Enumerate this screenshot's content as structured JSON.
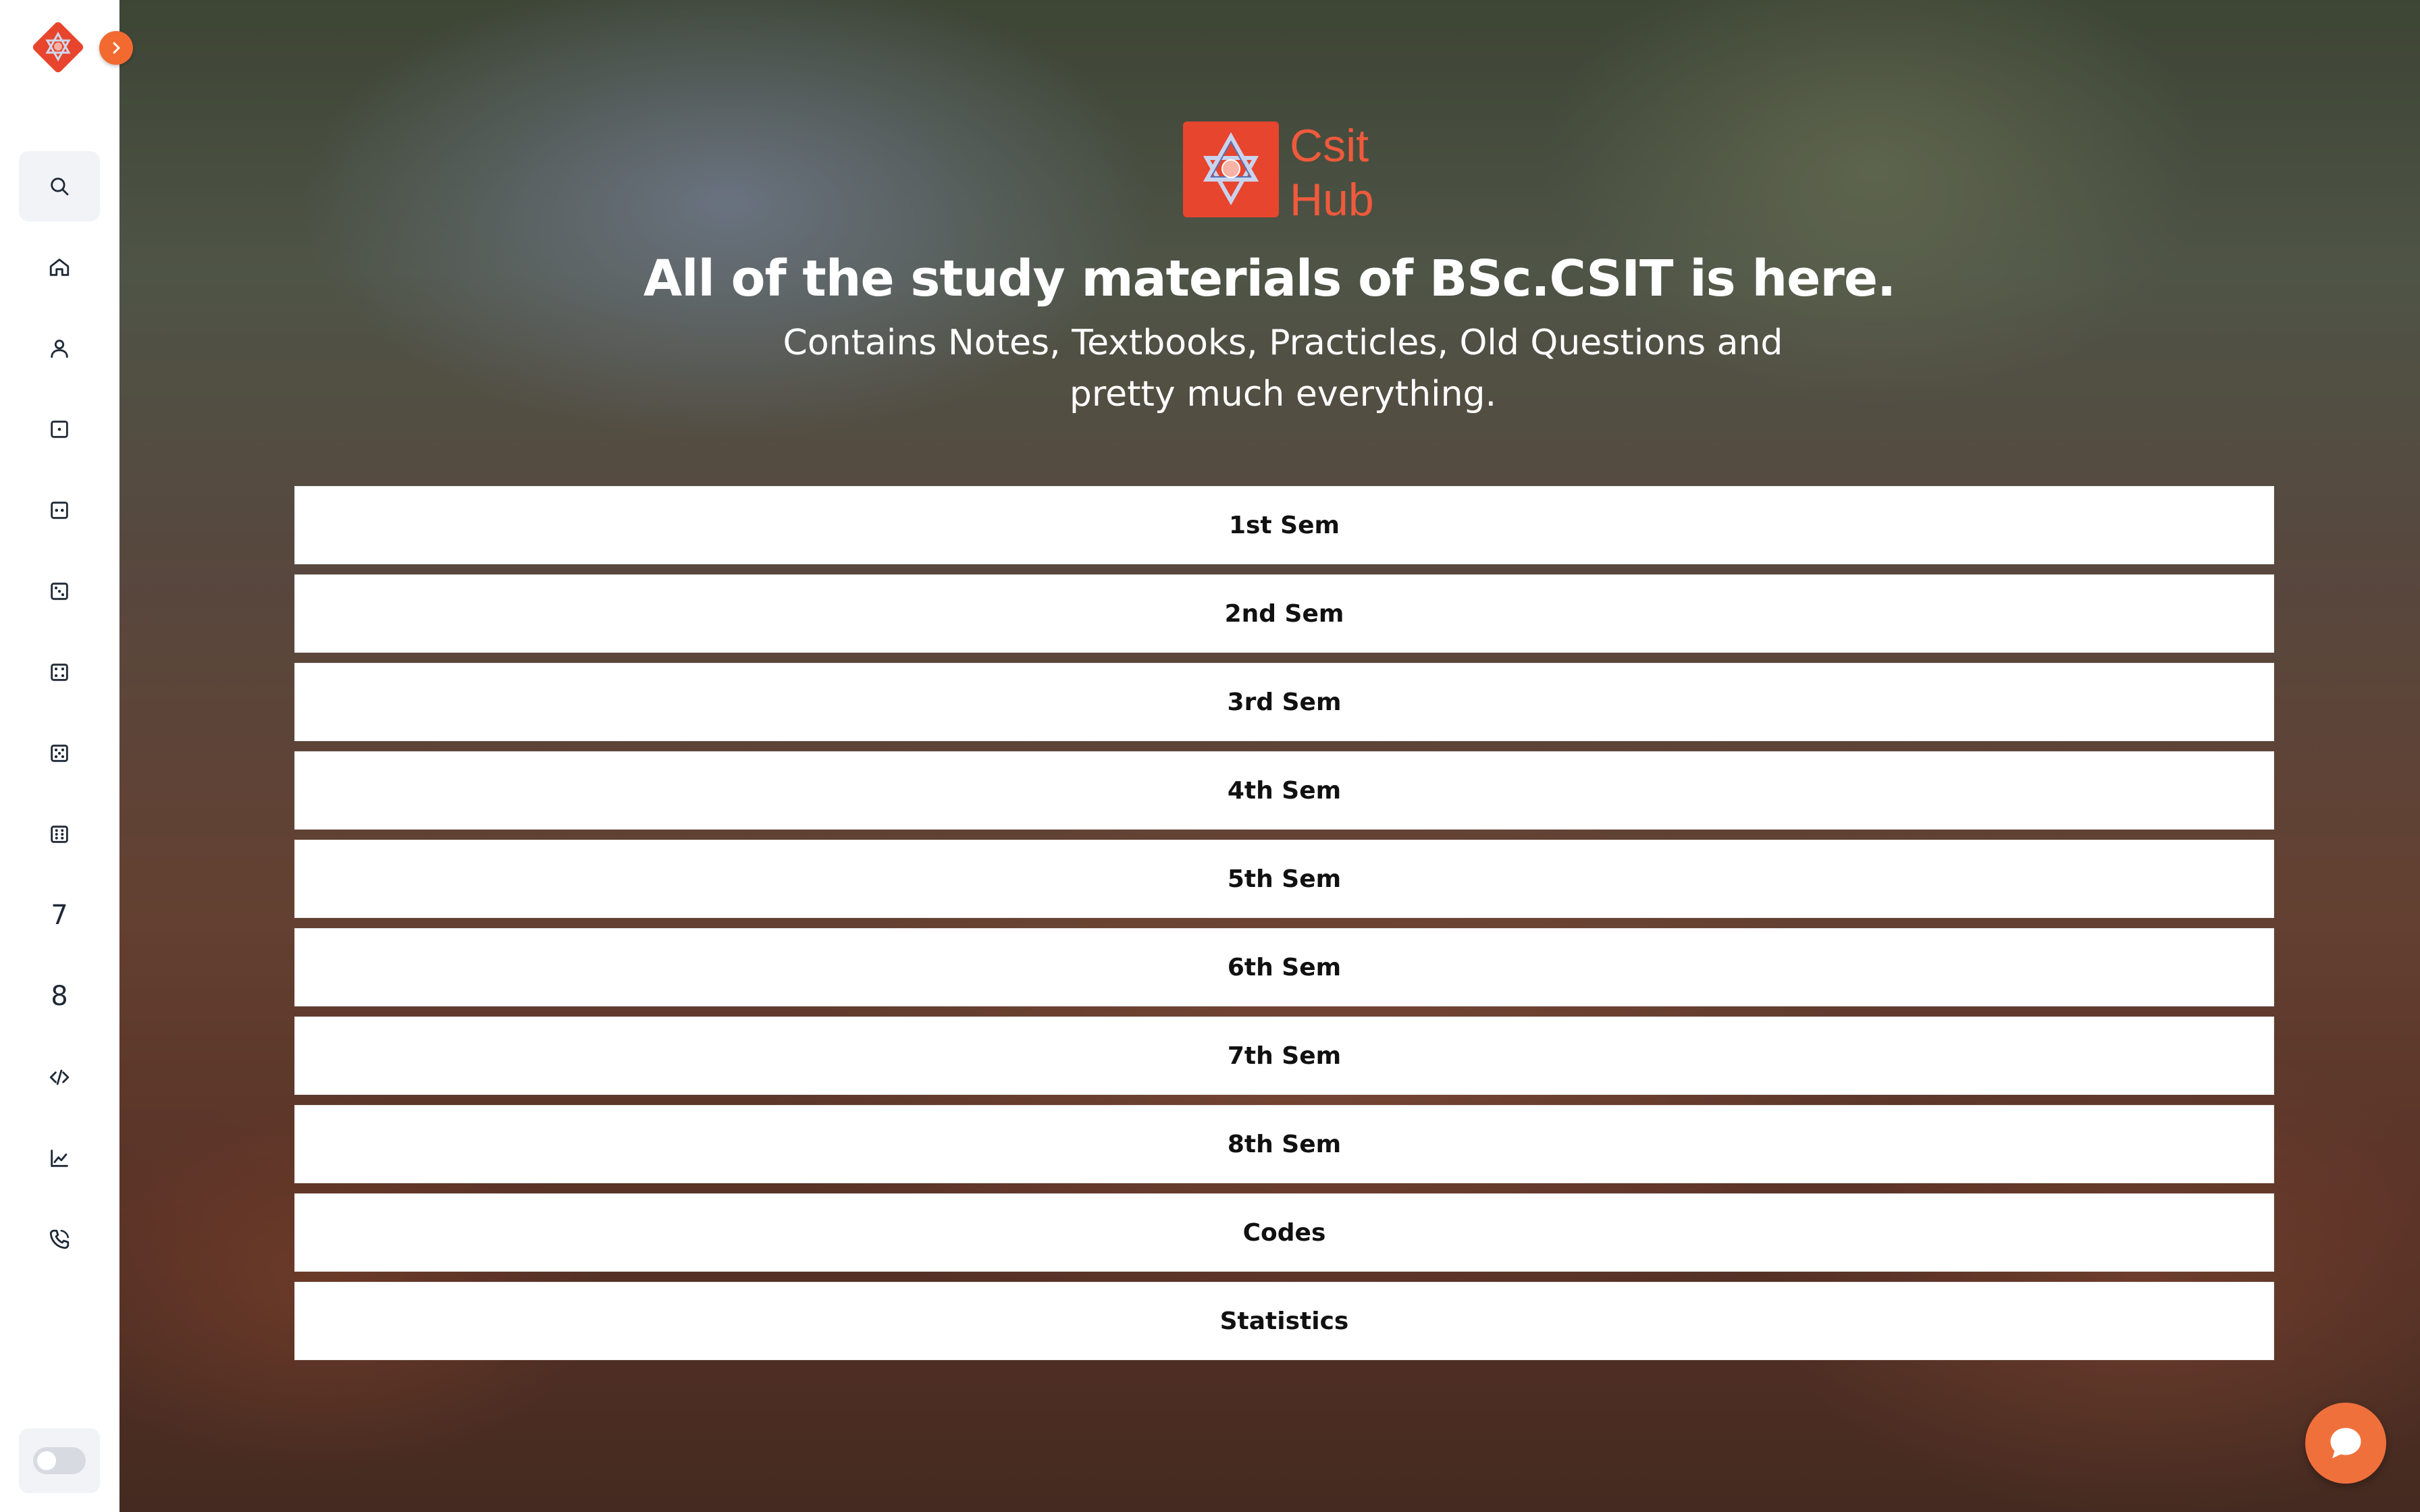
{
  "brand": {
    "line1": "Csit",
    "line2": "Hub",
    "accent_color": "#f05a3c"
  },
  "hero": {
    "headline": "All of the study materials of BSc.CSIT is here.",
    "subline_1": "Contains Notes, Textbooks, Practicles, Old Questions and",
    "subline_2": "pretty much everything."
  },
  "sidebar": {
    "items": [
      {
        "icon": "search-icon"
      },
      {
        "icon": "home-icon"
      },
      {
        "icon": "user-icon"
      },
      {
        "icon": "dice-one-icon"
      },
      {
        "icon": "dice-two-icon"
      },
      {
        "icon": "dice-three-icon"
      },
      {
        "icon": "dice-four-icon"
      },
      {
        "icon": "dice-five-icon"
      },
      {
        "icon": "dice-six-icon"
      },
      {
        "icon": "number-seven",
        "text": "7"
      },
      {
        "icon": "number-eight",
        "text": "8"
      },
      {
        "icon": "code-icon"
      },
      {
        "icon": "chart-line-icon"
      },
      {
        "icon": "phone-icon"
      }
    ]
  },
  "semesters": [
    {
      "label": "1st Sem"
    },
    {
      "label": "2nd Sem"
    },
    {
      "label": "3rd Sem"
    },
    {
      "label": "4th Sem"
    },
    {
      "label": "5th Sem"
    },
    {
      "label": "6th Sem"
    },
    {
      "label": "7th Sem"
    },
    {
      "label": "8th Sem"
    },
    {
      "label": "Codes"
    },
    {
      "label": "Statistics"
    }
  ],
  "colors": {
    "accent": "#f26a30",
    "chat": "#f0703c"
  }
}
